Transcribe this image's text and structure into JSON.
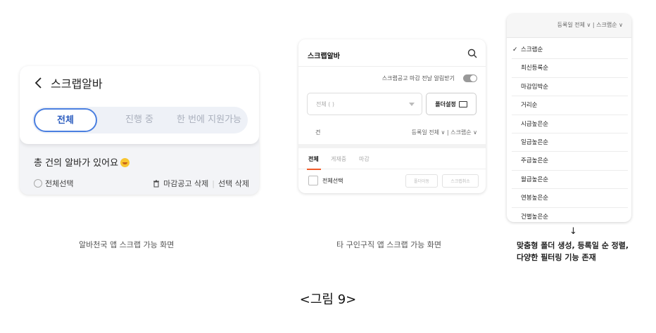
{
  "panel1": {
    "title": "스크랩알바",
    "tabs": [
      "전체",
      "진행 중",
      "한 번에 지원가능"
    ],
    "total_text": "총  건의 알바가 있어요",
    "select_all": "전체선택",
    "delete_expired": "마감공고 삭제",
    "delete_selected": "선택 삭제",
    "caption": "알바천국 앱 스크랩 가능 화면"
  },
  "panel2": {
    "title": "스크랩알바",
    "alarm_text": "스크랩공고 마감 전날 알림받기",
    "select_value": "전체 (  )",
    "folder_button": "폴더설정",
    "count_text": "건",
    "sort_text": "등록일 전체 ∨  |  스크랩순 ∨",
    "tabs": [
      "전체",
      "게재중",
      "마감"
    ],
    "select_all": "전체선택",
    "move_folder": "폴더이동",
    "cancel_scrap": "스크랩취소",
    "caption": "타 구인구직 앱 스크랩 가능 화면"
  },
  "panel3": {
    "header": "등록일 전체 ∨  |  스크랩순 ∨",
    "check_mark": "✓",
    "items": [
      "스크랩순",
      "최신등록순",
      "마감임박순",
      "거리순",
      "시급높은순",
      "일급높은순",
      "주급높은순",
      "월급높은순",
      "연봉높은순",
      "건별높은순"
    ],
    "arrow": "↓",
    "caption_line1": "맞춤형 폴더 생성, 등록일 순 정렬,",
    "caption_line2": "다양한 필터링 기능 존재"
  },
  "figure_label": "<그림  9>",
  "colors": {
    "accent_blue": "#4a7fe0",
    "tab_underline": "#f05a28",
    "panel_bg": "#f3f4f7"
  }
}
